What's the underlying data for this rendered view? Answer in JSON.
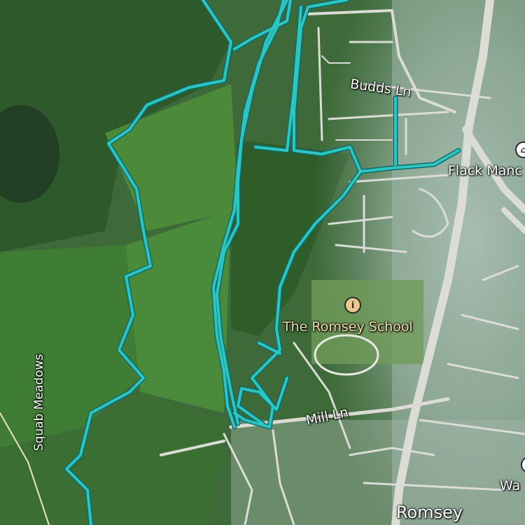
{
  "map": {
    "colors": {
      "trail": "#2ec4c0",
      "trail_outline": "#0d6b6a",
      "road": "#d9d9d6",
      "urban_haze": "#bfcfc8",
      "field_dark": "#2f5e2c",
      "field_light": "#4f8a3c"
    },
    "labels": {
      "budds_ln": "Budds Ln",
      "flack_manor": "Flack Manc",
      "romsey_school": "The Romsey School",
      "squab_meadows": "Squab Meadows",
      "mill_ln": "Mill Ln",
      "romsey": "Romsey",
      "wa": "Wa"
    },
    "icons": {
      "school": "school-icon",
      "manor": "building-icon",
      "west": "poi-icon"
    }
  }
}
